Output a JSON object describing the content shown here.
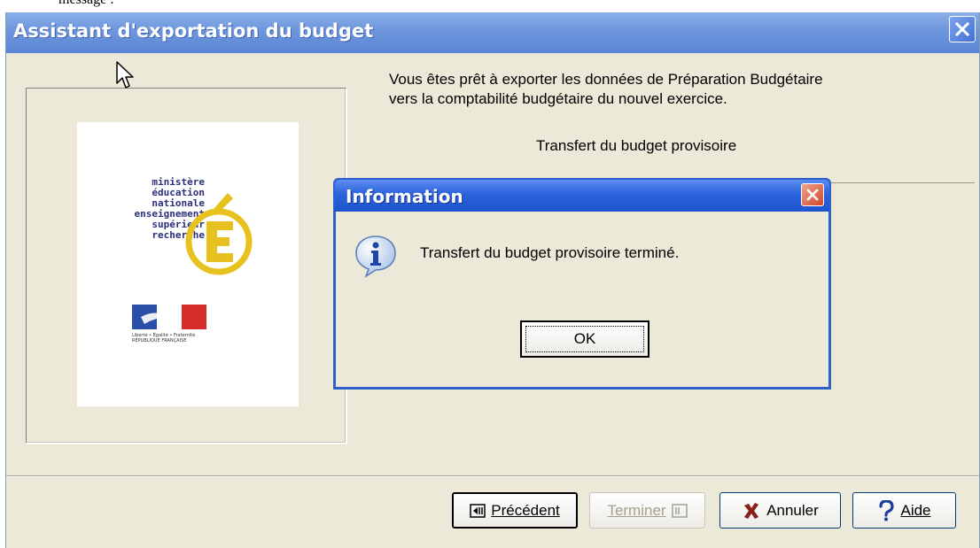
{
  "page": {
    "above_text": "message :"
  },
  "window": {
    "title": "Assistant d'exportation du budget",
    "intro_line1": "Vous êtes prêt à exporter les données de Préparation Budgétaire",
    "intro_line2": "vers la comptabilité budgétaire du nouvel exercice.",
    "subheading": "Transfert du budget provisoire",
    "logo": {
      "text_lines": [
        "ministère",
        "éducation",
        "nationale",
        "enseignement",
        "supérieur",
        "recherche"
      ],
      "flag_caption": "Liberté • Égalité • Fraternité RÉPUBLIQUE FRANÇAISE"
    },
    "buttons": {
      "previous": "Précédent",
      "finish": "Terminer",
      "cancel": "Annuler",
      "help": "Aide"
    }
  },
  "dialog": {
    "title": "Information",
    "message": "Transfert du budget provisoire terminé.",
    "ok": "OK"
  },
  "colors": {
    "titlebar": "#6f97dd",
    "dialog_titlebar": "#2c63db",
    "face": "#ece9d8"
  }
}
